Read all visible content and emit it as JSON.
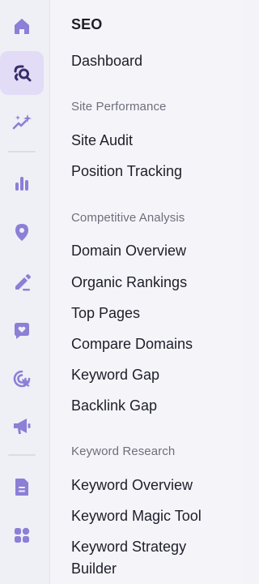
{
  "rail": {
    "accent": "#8b7fd6",
    "active_bg": "#e2dcf7",
    "active_icon_color": "#3a2e6a",
    "icons": [
      {
        "name": "home-icon"
      },
      {
        "name": "seo-icon"
      },
      {
        "name": "sparkles-icon"
      },
      {
        "name": "bar-chart-icon"
      },
      {
        "name": "location-pin-icon"
      },
      {
        "name": "edit-pen-icon"
      },
      {
        "name": "heart-chat-icon"
      },
      {
        "name": "target-cursor-icon"
      },
      {
        "name": "megaphone-icon"
      },
      {
        "name": "document-icon"
      },
      {
        "name": "apps-grid-icon"
      }
    ]
  },
  "menu": {
    "title": "SEO",
    "dashboard": "Dashboard",
    "sections": [
      {
        "label": "Site Performance",
        "items": [
          "Site Audit",
          "Position Tracking"
        ]
      },
      {
        "label": "Competitive Analysis",
        "items": [
          "Domain Overview",
          "Organic Rankings",
          "Top Pages",
          "Compare Domains",
          "Keyword Gap",
          "Backlink Gap"
        ]
      },
      {
        "label": "Keyword Research",
        "items": [
          "Keyword Overview",
          "Keyword Magic Tool",
          "Keyword Strategy Builder"
        ]
      }
    ]
  }
}
